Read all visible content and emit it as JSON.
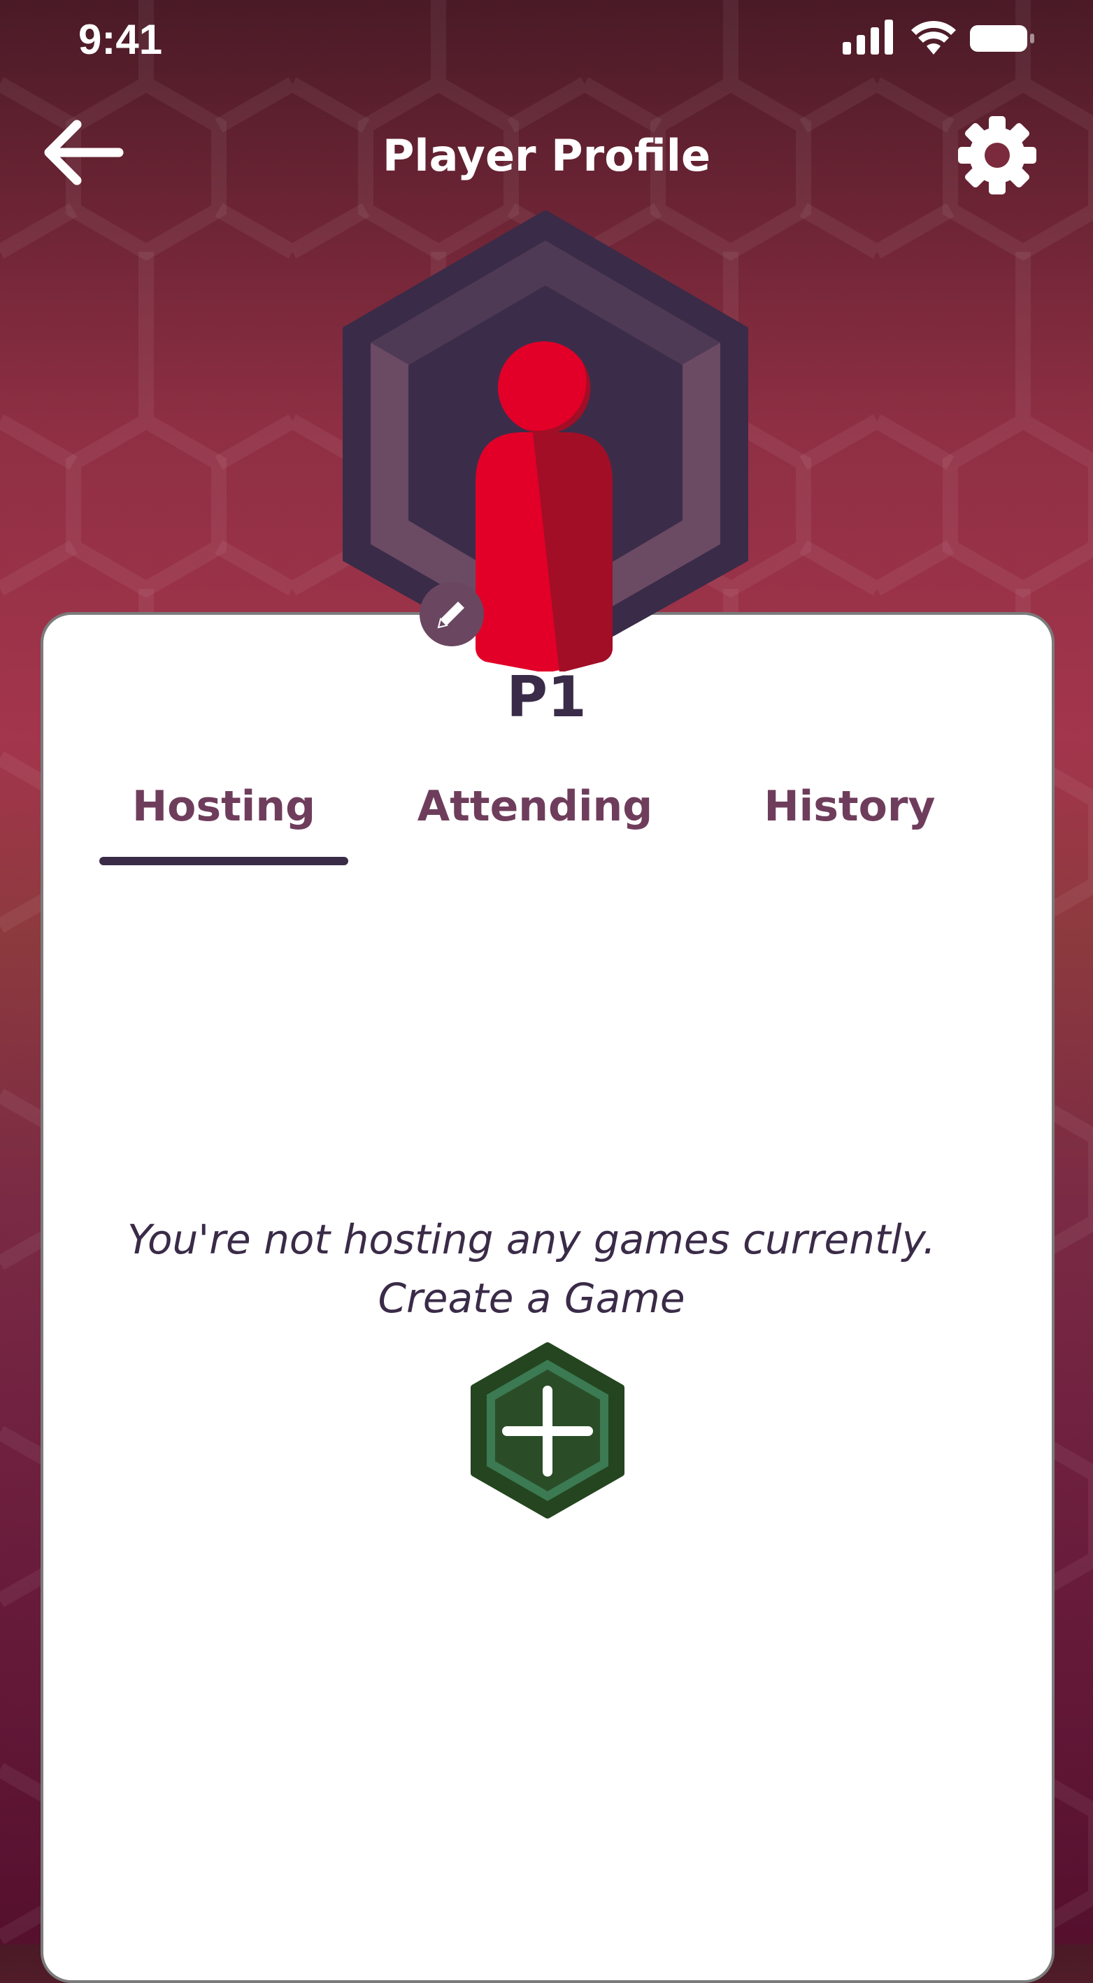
{
  "status_bar": {
    "time": "9:41"
  },
  "nav": {
    "title": "Player Profile"
  },
  "profile": {
    "player_name": "P1"
  },
  "tabs": [
    {
      "label": "Hosting",
      "selected": true
    },
    {
      "label": "Attending",
      "selected": false
    },
    {
      "label": "History",
      "selected": false
    }
  ],
  "empty_state": {
    "message": "You're not hosting any games currently.",
    "action_label": "Create a Game"
  },
  "colors": {
    "background_top": "#4a1a26",
    "background_mid": "#a3354c",
    "background_bottom": "#55102e",
    "card": "#ffffff",
    "text_dark": "#3a2b48",
    "tab_text": "#6f3d5c",
    "avatar_red": "#e20028",
    "avatar_frame": "#3a2b48",
    "create_green": "#2a4d28"
  },
  "icons": {
    "back": "arrow-left-icon",
    "settings": "gear-icon",
    "edit": "pencil-icon",
    "create": "plus-icon",
    "avatar": "player-pawn-icon"
  }
}
